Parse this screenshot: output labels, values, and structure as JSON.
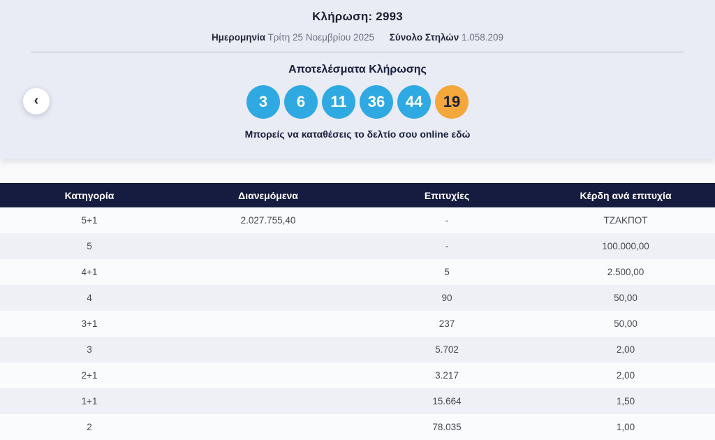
{
  "header": {
    "draw_label": "Κλήρωση:",
    "draw_number": "2993",
    "date_label": "Ημερομηνία",
    "date_value": "Τρίτη 25 Νοεμβρίου 2025",
    "columns_label": "Σύνολο Στηλών",
    "columns_value": "1.058.209"
  },
  "nav": {
    "prev_icon": "‹"
  },
  "results": {
    "title": "Αποτελέσματα Κλήρωσης",
    "numbers": [
      "3",
      "6",
      "11",
      "36",
      "44"
    ],
    "joker": "19",
    "cta_text": "Μπορείς να καταθέσεις το δελτίο σου online εδώ"
  },
  "colors": {
    "ball_blue": "#2fa9e1",
    "ball_orange": "#f4a73a",
    "header_navy": "#161c3f",
    "hero_background": "#e9ebf5"
  },
  "table": {
    "headers": [
      "Κατηγορία",
      "Διανεμόμενα",
      "Επιτυχίες",
      "Κέρδη ανά επιτυχία"
    ],
    "rows": [
      {
        "category": "5+1",
        "distributed": "2.027.755,40",
        "winners": "-",
        "prize": "ΤΖΑΚΠΟΤ"
      },
      {
        "category": "5",
        "distributed": "",
        "winners": "-",
        "prize": "100.000,00"
      },
      {
        "category": "4+1",
        "distributed": "",
        "winners": "5",
        "prize": "2.500,00"
      },
      {
        "category": "4",
        "distributed": "",
        "winners": "90",
        "prize": "50,00"
      },
      {
        "category": "3+1",
        "distributed": "",
        "winners": "237",
        "prize": "50,00"
      },
      {
        "category": "3",
        "distributed": "",
        "winners": "5.702",
        "prize": "2,00"
      },
      {
        "category": "2+1",
        "distributed": "",
        "winners": "3.217",
        "prize": "2,00"
      },
      {
        "category": "1+1",
        "distributed": "",
        "winners": "15.664",
        "prize": "1,50"
      },
      {
        "category": "2",
        "distributed": "",
        "winners": "78.035",
        "prize": "1,00"
      }
    ]
  }
}
